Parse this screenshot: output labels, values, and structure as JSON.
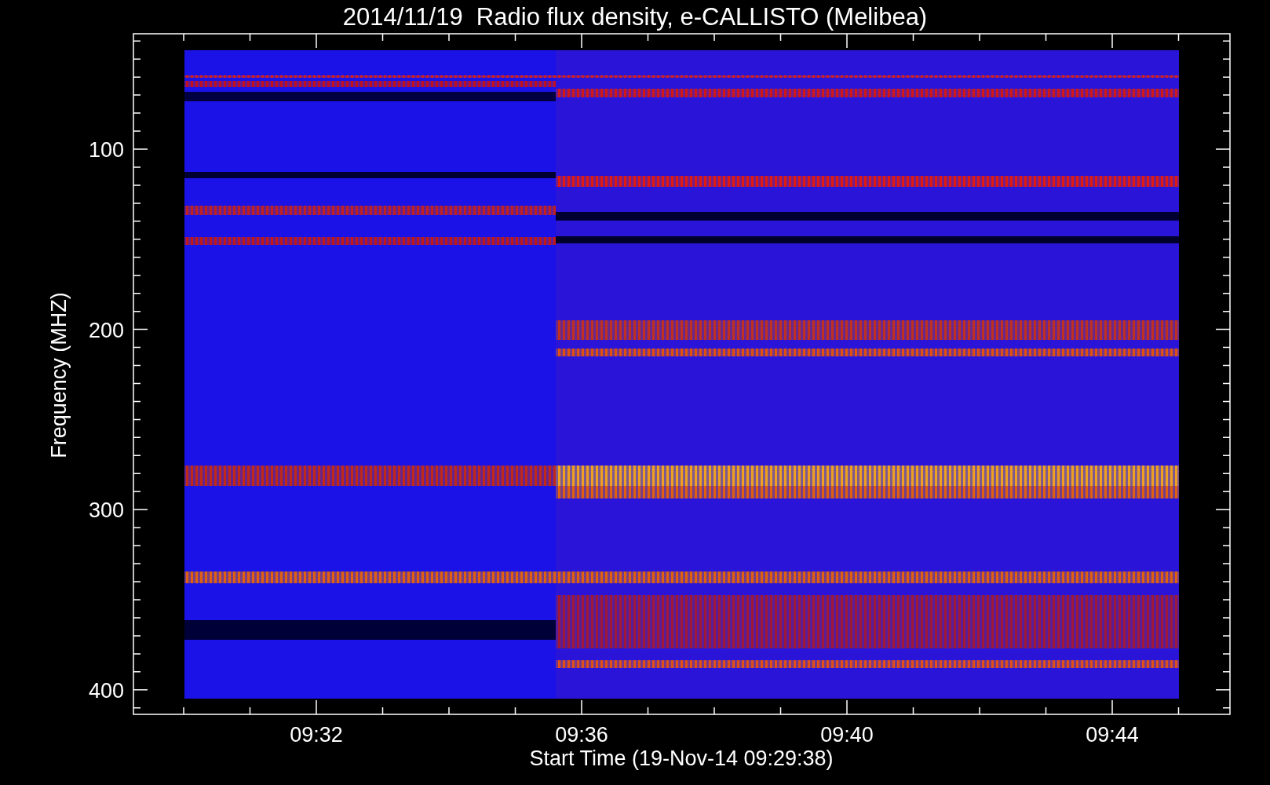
{
  "title": "2014/11/19  Radio flux density, e-CALLISTO (Melibea)",
  "y_axis": {
    "label": "Frequency (MHZ)",
    "ticks": [
      "100",
      "200",
      "300",
      "400"
    ]
  },
  "x_axis": {
    "label": "Start Time (19-Nov-14 09:29:38)",
    "ticks": [
      "09:32",
      "09:36",
      "09:40",
      "09:44"
    ]
  }
}
